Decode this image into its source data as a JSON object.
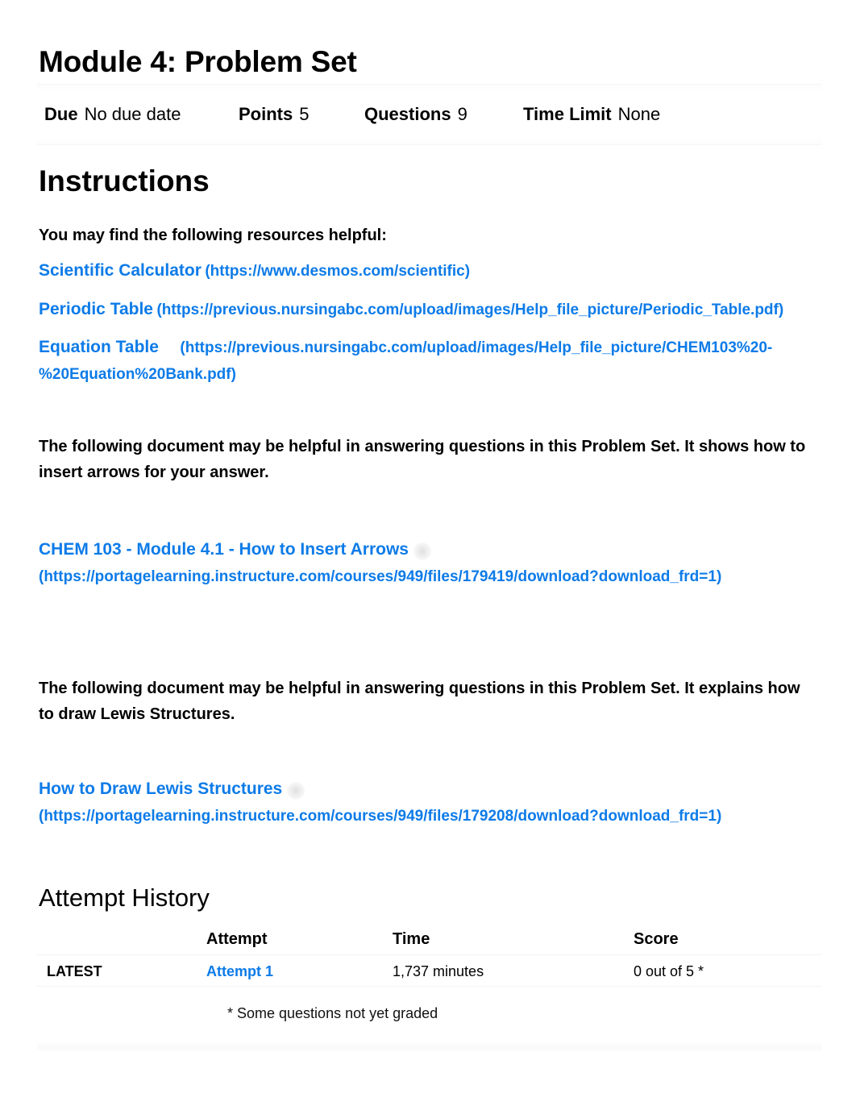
{
  "header": {
    "title": "Module 4: Problem Set"
  },
  "meta": {
    "due_label": "Due",
    "due_value": "No due date",
    "points_label": "Points",
    "points_value": "5",
    "questions_label": "Questions",
    "questions_value": "9",
    "time_limit_label": "Time Limit",
    "time_limit_value": "None"
  },
  "instructions": {
    "heading": "Instructions",
    "intro": "You may find the following resources helpful:",
    "resources": [
      {
        "name": "Scientific Calculator",
        "url": "(https://www.desmos.com/scientific)"
      },
      {
        "name": "Periodic Table",
        "url": "(https://previous.nursingabc.com/upload/images/Help_file_picture/Periodic_Table.pdf)"
      },
      {
        "name": "Equation Table",
        "url": "(https://previous.nursingabc.com/upload/images/Help_file_picture/CHEM103%20-%20Equation%20Bank.pdf)"
      }
    ],
    "doc1_text": "The following document may be helpful in answering questions in this Problem Set. It shows how to insert arrows for your answer.",
    "doc1_link": {
      "name": "CHEM 103 - Module 4.1 - How to Insert Arrows",
      "url": "(https://portagelearning.instructure.com/courses/949/files/179419/download?download_frd=1)"
    },
    "doc2_text": "The following document may be helpful in answering questions in this Problem Set. It explains how to draw Lewis Structures.",
    "doc2_link": {
      "name": "How to Draw Lewis Structures",
      "url": "(https://portagelearning.instructure.com/courses/949/files/179208/download?download_frd=1)"
    }
  },
  "attempt_history": {
    "heading": "Attempt History",
    "columns": [
      "",
      "Attempt",
      "Time",
      "Score"
    ],
    "rows": [
      {
        "tag": "LATEST",
        "attempt": "Attempt 1",
        "time": "1,737 minutes",
        "score": "0 out of 5 *"
      }
    ],
    "footnote": "* Some questions not yet graded"
  },
  "colors": {
    "link": "#0d7be8",
    "text": "#000000"
  }
}
